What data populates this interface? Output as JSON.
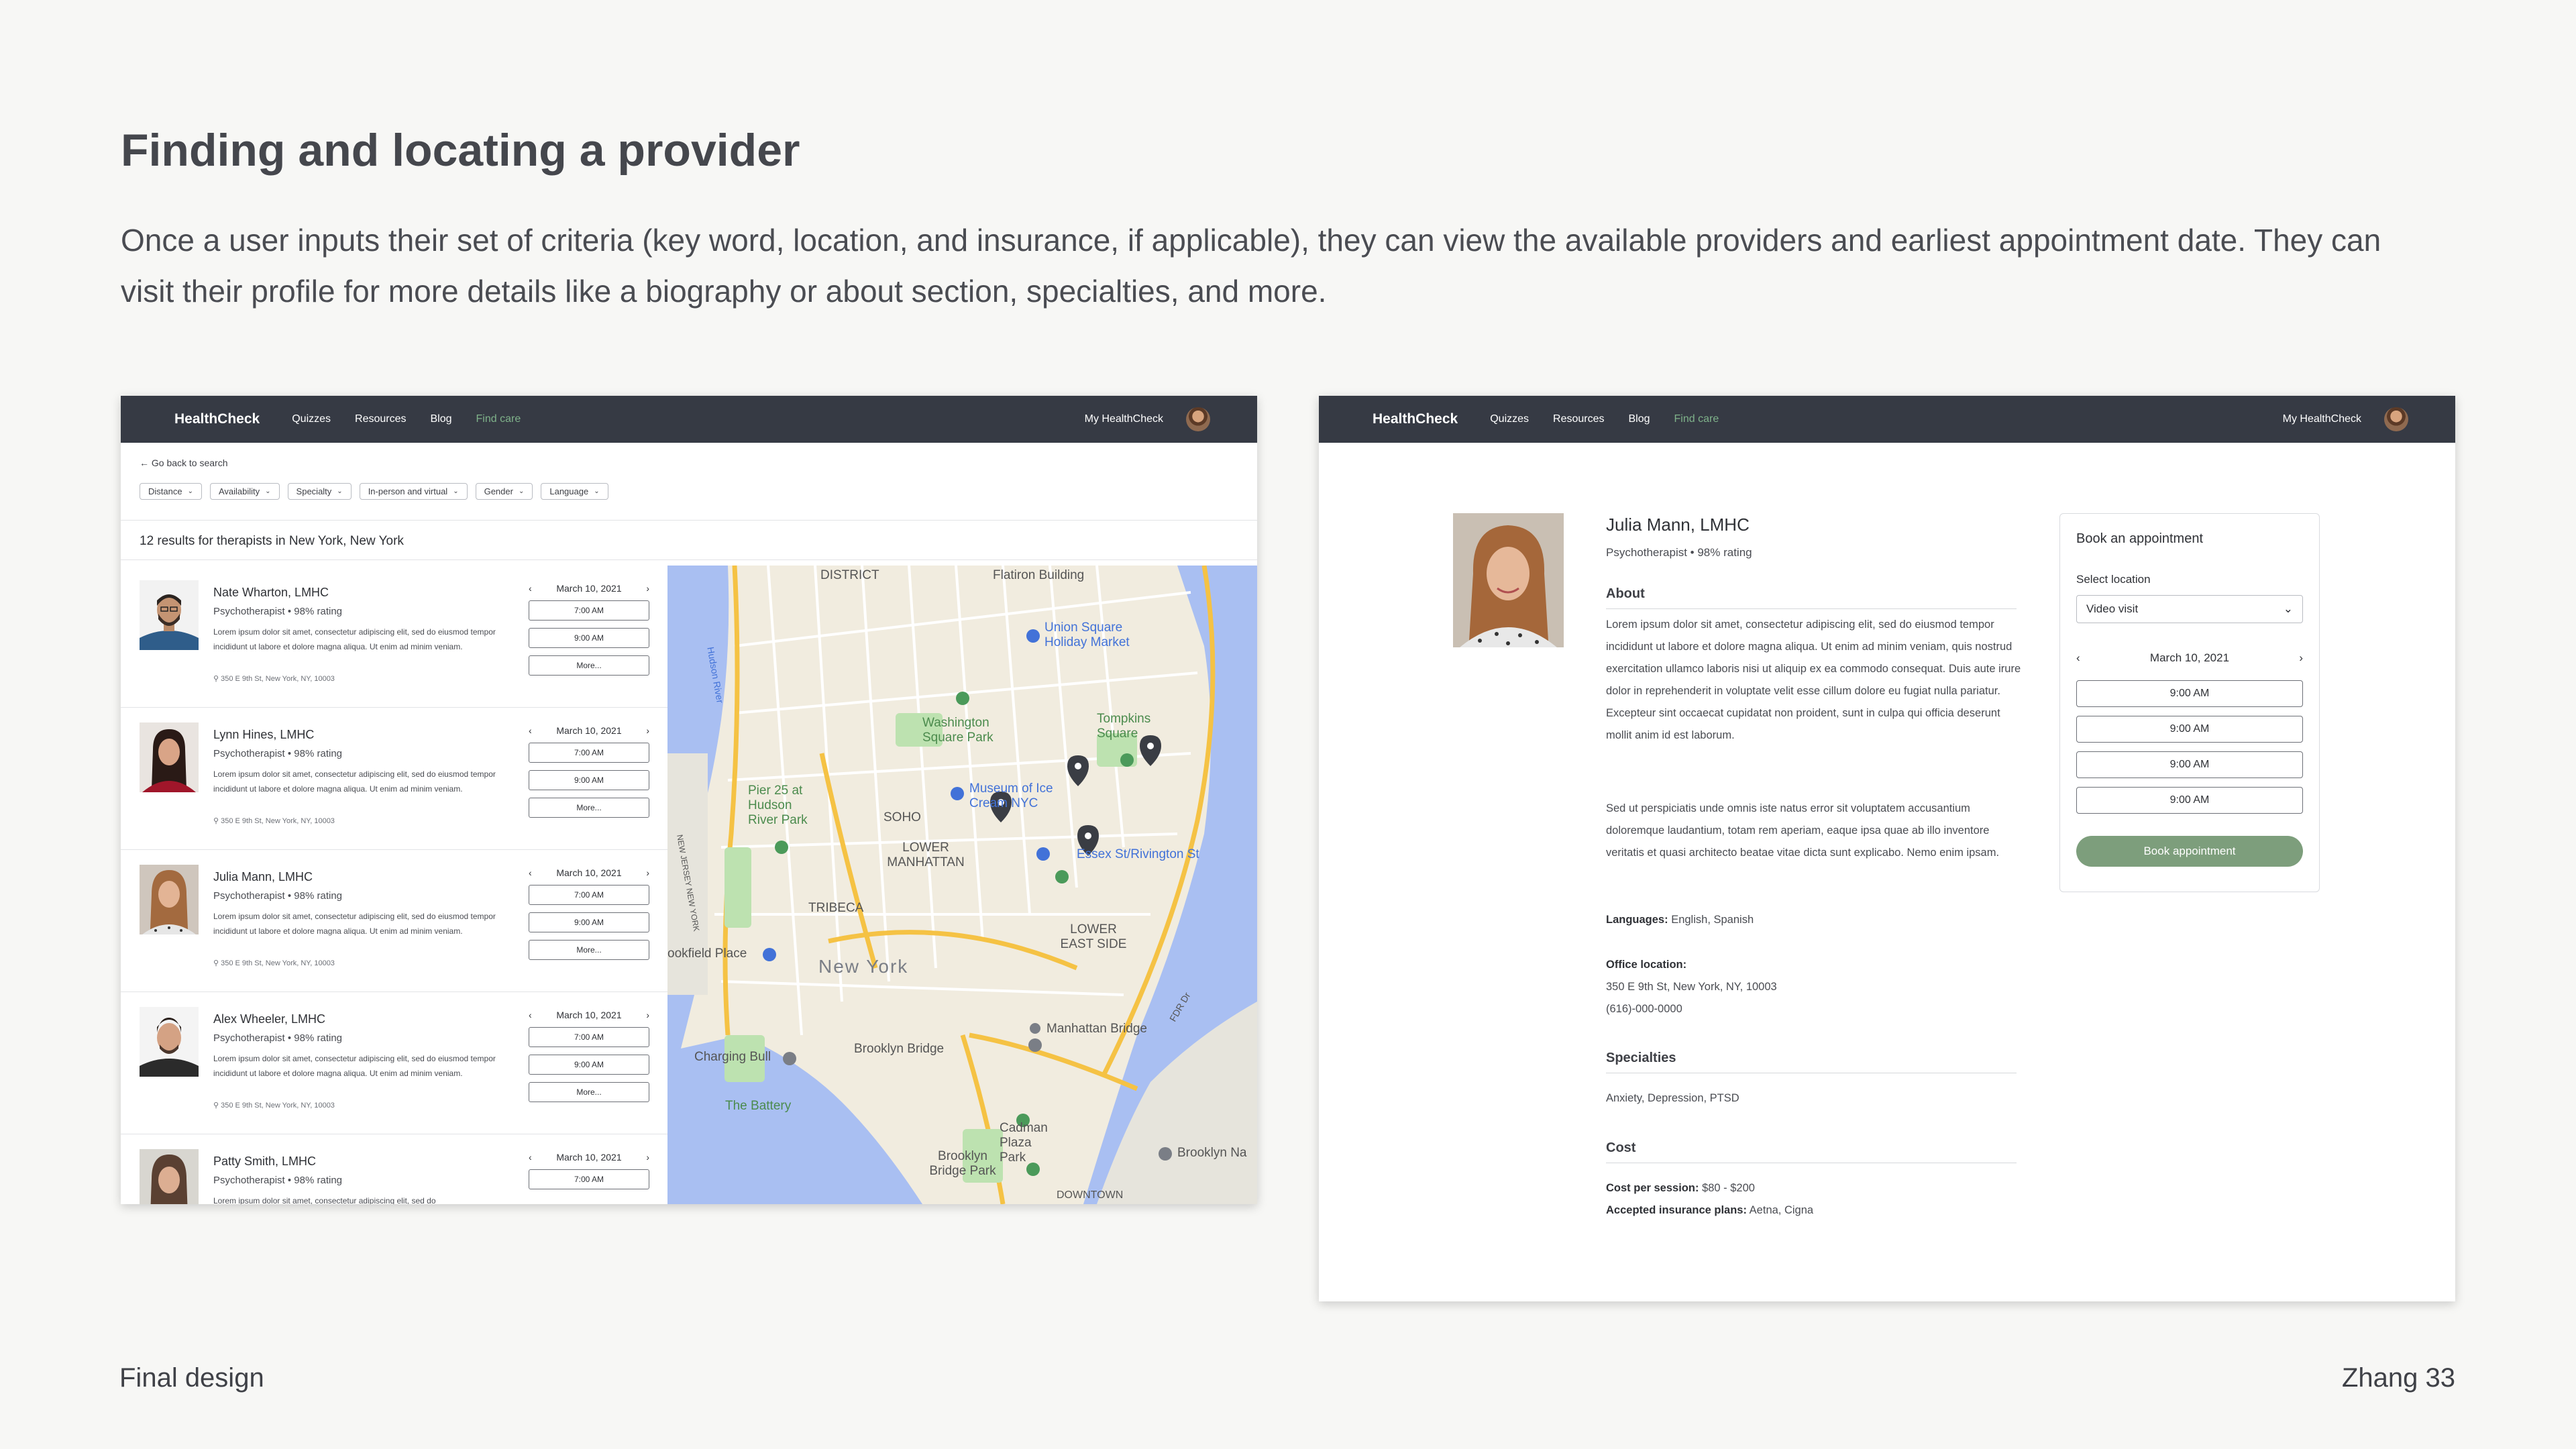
{
  "slide": {
    "title": "Finding and locating a provider",
    "description": "Once a user inputs their set of criteria (key word, location, and insurance, if applicable), they can view the available providers and earliest appointment date. They can visit their profile for more details like a biography or about section, specialties, and more.",
    "footer_left": "Final design",
    "footer_right": "Zhang 33"
  },
  "nav": {
    "brand": "HealthCheck",
    "items": [
      "Quizzes",
      "Resources",
      "Blog",
      "Find care"
    ],
    "active_item": "Find care",
    "account": "My HealthCheck"
  },
  "search": {
    "back_link": "Go back to search",
    "filters": [
      "Distance",
      "Availability",
      "Specialty",
      "In-person and virtual",
      "Gender",
      "Language"
    ],
    "results_text": "12 results for therapists in New York, New York"
  },
  "providers": [
    {
      "name": "Nate Wharton, LMHC",
      "meta": "Psychotherapist • 98% rating",
      "text": "Lorem ipsum dolor sit amet, consectetur adipiscing elit, sed do eiusmod tempor incididunt ut labore et dolore magna aliqua. Ut enim ad minim veniam.",
      "address": "350 E 9th St, New York, NY, 10003",
      "date": "March 10, 2021",
      "slots": [
        "7:00 AM",
        "9:00 AM"
      ],
      "more": "More..."
    },
    {
      "name": "Lynn Hines, LMHC",
      "meta": "Psychotherapist • 98% rating",
      "text": "Lorem ipsum dolor sit amet, consectetur adipiscing elit, sed do eiusmod tempor incididunt ut labore et dolore magna aliqua. Ut enim ad minim veniam.",
      "address": "350 E 9th St, New York, NY, 10003",
      "date": "March 10, 2021",
      "slots": [
        "7:00 AM",
        "9:00 AM"
      ],
      "more": "More..."
    },
    {
      "name": "Julia Mann, LMHC",
      "meta": "Psychotherapist • 98% rating",
      "text": "Lorem ipsum dolor sit amet, consectetur adipiscing elit, sed do eiusmod tempor incididunt ut labore et dolore magna aliqua. Ut enim ad minim veniam.",
      "address": "350 E 9th St, New York, NY, 10003",
      "date": "March 10, 2021",
      "slots": [
        "7:00 AM",
        "9:00 AM"
      ],
      "more": "More..."
    },
    {
      "name": "Alex Wheeler, LMHC",
      "meta": "Psychotherapist • 98% rating",
      "text": "Lorem ipsum dolor sit amet, consectetur adipiscing elit, sed do eiusmod tempor incididunt ut labore et dolore magna aliqua. Ut enim ad minim veniam.",
      "address": "350 E 9th St, New York, NY, 10003",
      "date": "March 10, 2021",
      "slots": [
        "7:00 AM",
        "9:00 AM"
      ],
      "more": "More..."
    },
    {
      "name": "Patty Smith, LMHC",
      "meta": "Psychotherapist • 98% rating",
      "text": "Lorem ipsum dolor sit amet, consectetur adipiscing elit, sed do",
      "address": "",
      "date": "March 10, 2021",
      "slots": [
        "7:00 AM"
      ],
      "more": ""
    }
  ],
  "map": {
    "labels": [
      "DISTRICT",
      "Flatiron Building",
      "Union Square Holiday Market",
      "Washington Square Park",
      "Tompkins Square",
      "Museum of Ice Cream NYC",
      "Pier 25 at Hudson River Park",
      "SOHO",
      "LOWER MANHATTAN",
      "Essex St/Rivington St",
      "TRIBECA",
      "LOWER EAST SIDE",
      "New York",
      "Manhattan Bridge",
      "Charging Bull",
      "Brooklyn Bridge",
      "The Battery",
      "Cadman Plaza Park",
      "Brooklyn Bridge Park",
      "Brooklyn Na",
      "DOWNTOWN",
      "Hudson River",
      "ookfield Place",
      "FDR Dr",
      "NEW JERSEY NEW YORK"
    ]
  },
  "profile": {
    "name": "Julia Mann, LMHC",
    "meta": "Psychotherapist • 98% rating",
    "about_heading": "About",
    "about_p1": "Lorem ipsum dolor sit amet, consectetur adipiscing elit, sed do eiusmod tempor incididunt ut labore et dolore magna aliqua. Ut enim ad minim veniam, quis nostrud exercitation ullamco laboris nisi ut aliquip ex ea commodo consequat. Duis aute irure dolor in reprehenderit in voluptate velit esse cillum dolore eu fugiat nulla pariatur. Excepteur sint occaecat cupidatat non proident, sunt in culpa qui officia deserunt mollit anim id est laborum.",
    "about_p2": "Sed ut perspiciatis unde omnis iste natus error sit voluptatem accusantium doloremque laudantium, totam rem aperiam, eaque ipsa quae ab illo inventore veritatis et quasi architecto beatae vitae dicta sunt explicabo. Nemo enim ipsam.",
    "languages_label": "Languages:",
    "languages_value": "English, Spanish",
    "office_label": "Office location:",
    "office_address": "350 E 9th St, New York, NY, 10003",
    "office_phone": "(616)-000-0000",
    "specialties_heading": "Specialties",
    "specialties_value": "Anxiety, Depression, PTSD",
    "cost_heading": "Cost",
    "cost_label": "Cost per session:",
    "cost_value": "$80 - $200",
    "insurance_label": "Accepted insurance plans:",
    "insurance_value": "Aetna, Cigna"
  },
  "booking": {
    "title": "Book an appointment",
    "location_label": "Select location",
    "location_value": "Video visit",
    "date": "March 10, 2021",
    "slots": [
      "9:00 AM",
      "9:00 AM",
      "9:00 AM",
      "9:00 AM"
    ],
    "button": "Book appointment"
  },
  "colors": {
    "navbar": "#363a44",
    "accent_green": "#7d9e7c",
    "active_nav": "#7fb28a",
    "map_water": "#a9bff2",
    "map_road": "#f5c244"
  }
}
